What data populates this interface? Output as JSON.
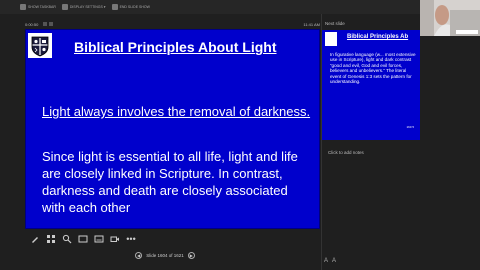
{
  "toolbar": {
    "items": [
      {
        "label": "SHOW TASKBAR",
        "icon": "taskbar-icon"
      },
      {
        "label": "DISPLAY SETTINGS ▾",
        "icon": "display-icon"
      },
      {
        "label": "END SLIDE SHOW",
        "icon": "end-show-icon"
      }
    ]
  },
  "timer": {
    "elapsed": "0:00:50",
    "clock": "11:41 AM"
  },
  "slide": {
    "title": "Biblical Principles About Light",
    "subtitle": "Light always involves the removal of darkness.",
    "body": "Since light is essential to all life, light and life are closely linked in Scripture. In contrast, darkness and death are closely associated with each other",
    "number_line1": "160",
    "number_line2": "4"
  },
  "navigation": {
    "counter": "Slide 1604 of 1621"
  },
  "next_slide": {
    "label": "Next slide",
    "title": "Biblical Principles Ab",
    "body": "In figurative language (w... most extensive use in Scripture), light and dark contrast “good and evil, God and evil forces, believers and unbelievers.” The literal event of Genesis 1:3 sets the pattern for understanding.",
    "number": "160 5"
  },
  "notes": {
    "placeholder": "Click to add notes"
  },
  "colors": {
    "slide_bg": "#0000cc",
    "app_bg": "#1f1f1f"
  }
}
